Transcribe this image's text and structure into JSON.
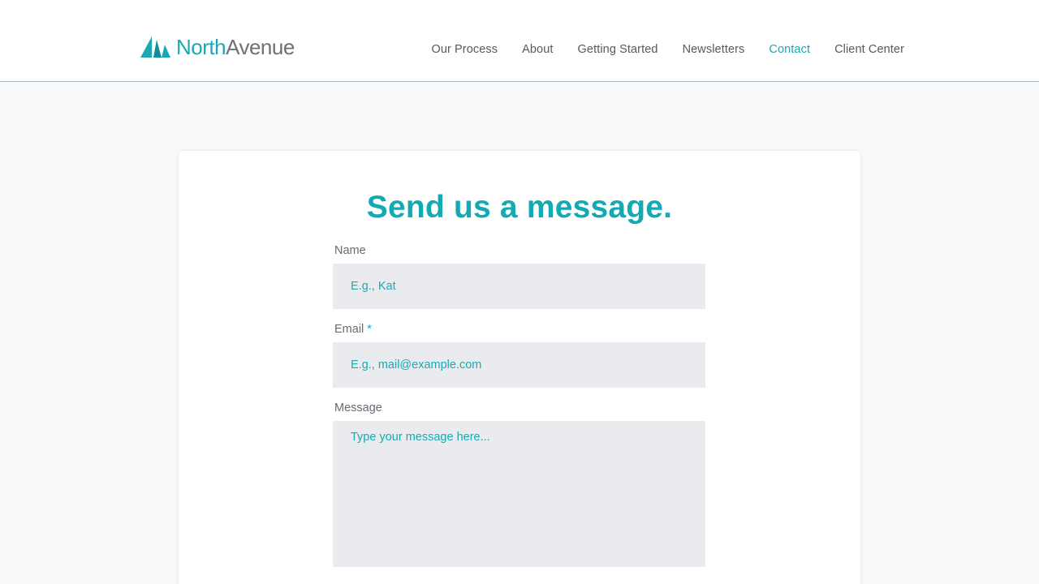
{
  "brand": {
    "logo_part1": "North",
    "logo_part2": "Avenue",
    "accent_color": "#1aa9b3",
    "logo_icon": "sail-icon"
  },
  "nav": {
    "items": [
      {
        "label": "Our Process"
      },
      {
        "label": "About"
      },
      {
        "label": "Getting Started"
      },
      {
        "label": "Newsletters"
      },
      {
        "label": "Contact",
        "active": true
      },
      {
        "label": "Client Center"
      }
    ]
  },
  "form": {
    "title": "Send us a message.",
    "name_label": "Name",
    "name_placeholder": "E.g., Kat",
    "email_label": "Email",
    "email_required_mark": "*",
    "email_placeholder": "E.g., mail@example.com",
    "message_label": "Message",
    "message_placeholder": "Type your message here..."
  }
}
